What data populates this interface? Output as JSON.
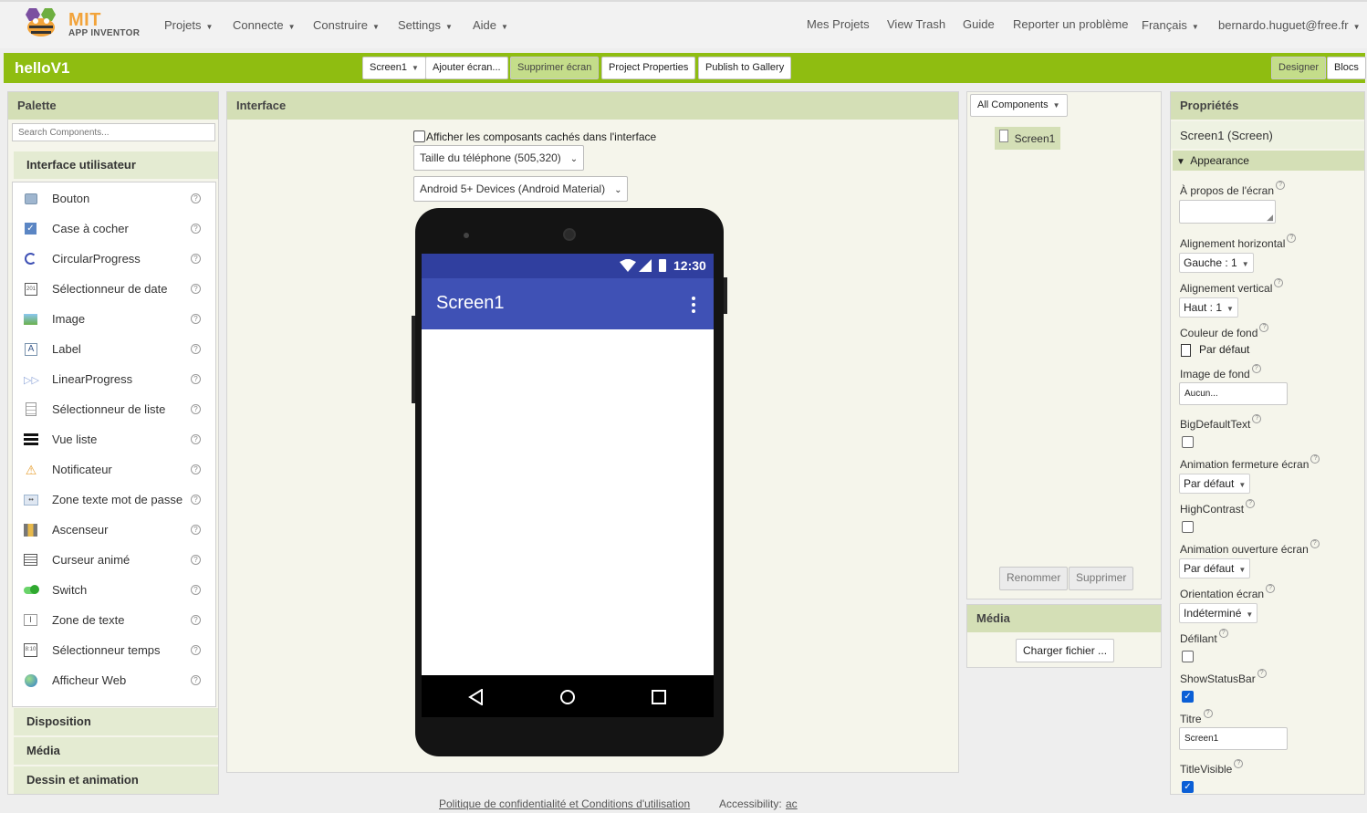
{
  "header": {
    "logo_mit": "MIT",
    "logo_app": "APP INVENTOR",
    "menus": [
      "Projets",
      "Connecte",
      "Construire",
      "Settings",
      "Aide"
    ],
    "right_links": [
      "Mes Projets",
      "View Trash",
      "Guide",
      "Reporter un problème"
    ],
    "language": "Français",
    "user": "bernardo.huguet@free.fr"
  },
  "project": {
    "name": "helloV1",
    "screen_select": "Screen1",
    "add_screen": "Ajouter écran...",
    "remove_screen": "Supprimer écran",
    "properties": "Project Properties",
    "publish": "Publish to Gallery",
    "designer": "Designer",
    "blocks": "Blocs"
  },
  "palette": {
    "title": "Palette",
    "search_placeholder": "Search Components...",
    "category": "Interface utilisateur",
    "items": [
      {
        "label": "Bouton",
        "icon": "button-icon"
      },
      {
        "label": "Case à cocher",
        "icon": "checkbox-icon"
      },
      {
        "label": "CircularProgress",
        "icon": "circular-progress-icon"
      },
      {
        "label": "Sélectionneur de date",
        "icon": "calendar-icon"
      },
      {
        "label": "Image",
        "icon": "image-icon"
      },
      {
        "label": "Label",
        "icon": "label-icon"
      },
      {
        "label": "LinearProgress",
        "icon": "linear-progress-icon"
      },
      {
        "label": "Sélectionneur de liste",
        "icon": "list-picker-icon"
      },
      {
        "label": "Vue liste",
        "icon": "list-view-icon"
      },
      {
        "label": "Notificateur",
        "icon": "warning-icon"
      },
      {
        "label": "Zone texte mot de passe",
        "icon": "password-icon"
      },
      {
        "label": "Ascenseur",
        "icon": "slider-icon"
      },
      {
        "label": "Curseur animé",
        "icon": "spinner-icon"
      },
      {
        "label": "Switch",
        "icon": "switch-icon"
      },
      {
        "label": "Zone de texte",
        "icon": "textbox-icon"
      },
      {
        "label": "Sélectionneur temps",
        "icon": "time-picker-icon"
      },
      {
        "label": "Afficheur Web",
        "icon": "web-viewer-icon"
      }
    ],
    "help": "?",
    "other_categories": [
      "Disposition",
      "Média",
      "Dessin et animation"
    ]
  },
  "viewer": {
    "title": "Interface",
    "show_hidden": "Afficher les composants cachés dans l'interface",
    "phone_size": "Taille du téléphone (505,320)",
    "theme": "Android 5+ Devices (Android Material)",
    "status_time": "12:30",
    "screen_title": "Screen1"
  },
  "components": {
    "dropdown": "All Components",
    "tree_item": "Screen1",
    "rename": "Renommer",
    "delete": "Supprimer"
  },
  "media": {
    "title": "Média",
    "upload": "Charger fichier ..."
  },
  "properties": {
    "title": "Propriétés",
    "subject": "Screen1 (Screen)",
    "group": "Appearance",
    "about_label": "À propos de l'écran",
    "halign_label": "Alignement horizontal",
    "halign_value": "Gauche : 1",
    "valign_label": "Alignement vertical",
    "valign_value": "Haut : 1",
    "bgcolor_label": "Couleur de fond",
    "bgcolor_value": "Par défaut",
    "bgimage_label": "Image de fond",
    "bgimage_value": "Aucun...",
    "bigtext_label": "BigDefaultText",
    "close_anim_label": "Animation fermeture écran",
    "close_anim_value": "Par défaut",
    "contrast_label": "HighContrast",
    "open_anim_label": "Animation ouverture écran",
    "open_anim_value": "Par défaut",
    "orientation_label": "Orientation écran",
    "orientation_value": "Indéterminé",
    "scrollable_label": "Défilant",
    "statusbar_label": "ShowStatusBar",
    "title_label": "Titre",
    "title_value": "Screen1",
    "titlevisible_label": "TitleVisible",
    "help": "?"
  },
  "footer": {
    "privacy": "Politique de confidentialité et Conditions d'utilisation",
    "accessibility": "Accessibility:",
    "accessibility_link": "ac"
  },
  "colors": {
    "brand_green": "#8fbd11",
    "android_primary": "#3f51b5",
    "android_dark": "#303f9f"
  }
}
